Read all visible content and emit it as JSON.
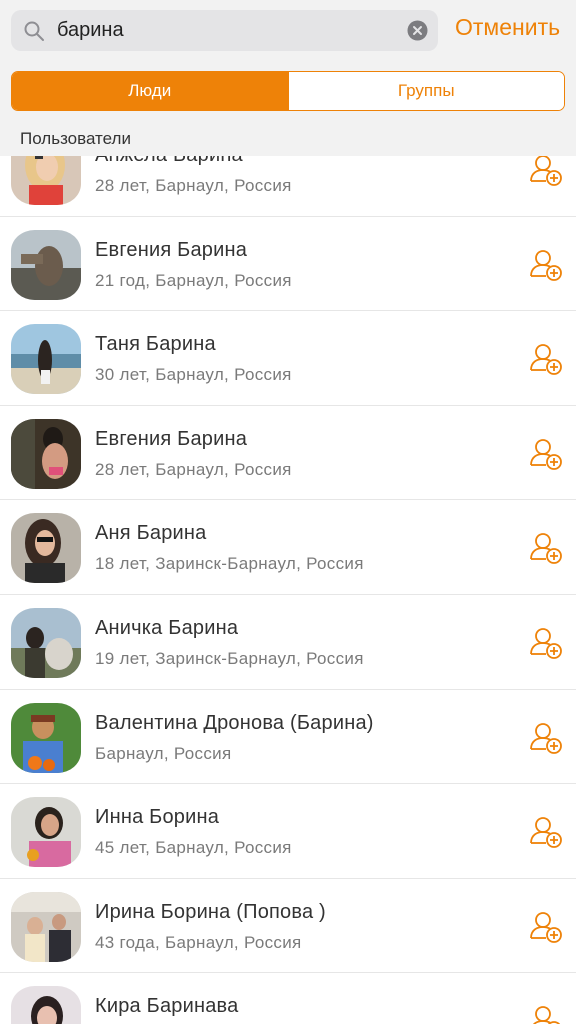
{
  "search": {
    "value": "барина",
    "cancel_label": "Отменить"
  },
  "tabs": [
    {
      "label": "Люди",
      "active": true
    },
    {
      "label": "Группы",
      "active": false
    }
  ],
  "section_label": "Пользователи",
  "colors": {
    "accent": "#ee8208",
    "header_bg": "#f2f2f2"
  },
  "icons": {
    "search": "search-icon",
    "clear": "clear-icon",
    "add_friend": "add-friend-icon"
  },
  "users": [
    {
      "name": "Анжела Барина",
      "details": "28 лет, Барнаул, Россия"
    },
    {
      "name": "Евгения Барина",
      "details": "21 год, Барнаул, Россия"
    },
    {
      "name": "Таня Барина",
      "details": "30 лет, Барнаул, Россия"
    },
    {
      "name": "Евгения Барина",
      "details": "28 лет, Барнаул, Россия"
    },
    {
      "name": "Аня Барина",
      "details": "18 лет, Заринск-Барнаул, Россия"
    },
    {
      "name": "Аничка Барина",
      "details": "19 лет, Заринск-Барнаул, Россия"
    },
    {
      "name": "Валентина Дронова (Барина)",
      "details": "Барнаул, Россия"
    },
    {
      "name": "Инна Борина",
      "details": "45 лет, Барнаул, Россия"
    },
    {
      "name": "Ирина Борина (Попова )",
      "details": "43 года, Барнаул, Россия"
    },
    {
      "name": "Кира Баринава",
      "details": ""
    }
  ]
}
